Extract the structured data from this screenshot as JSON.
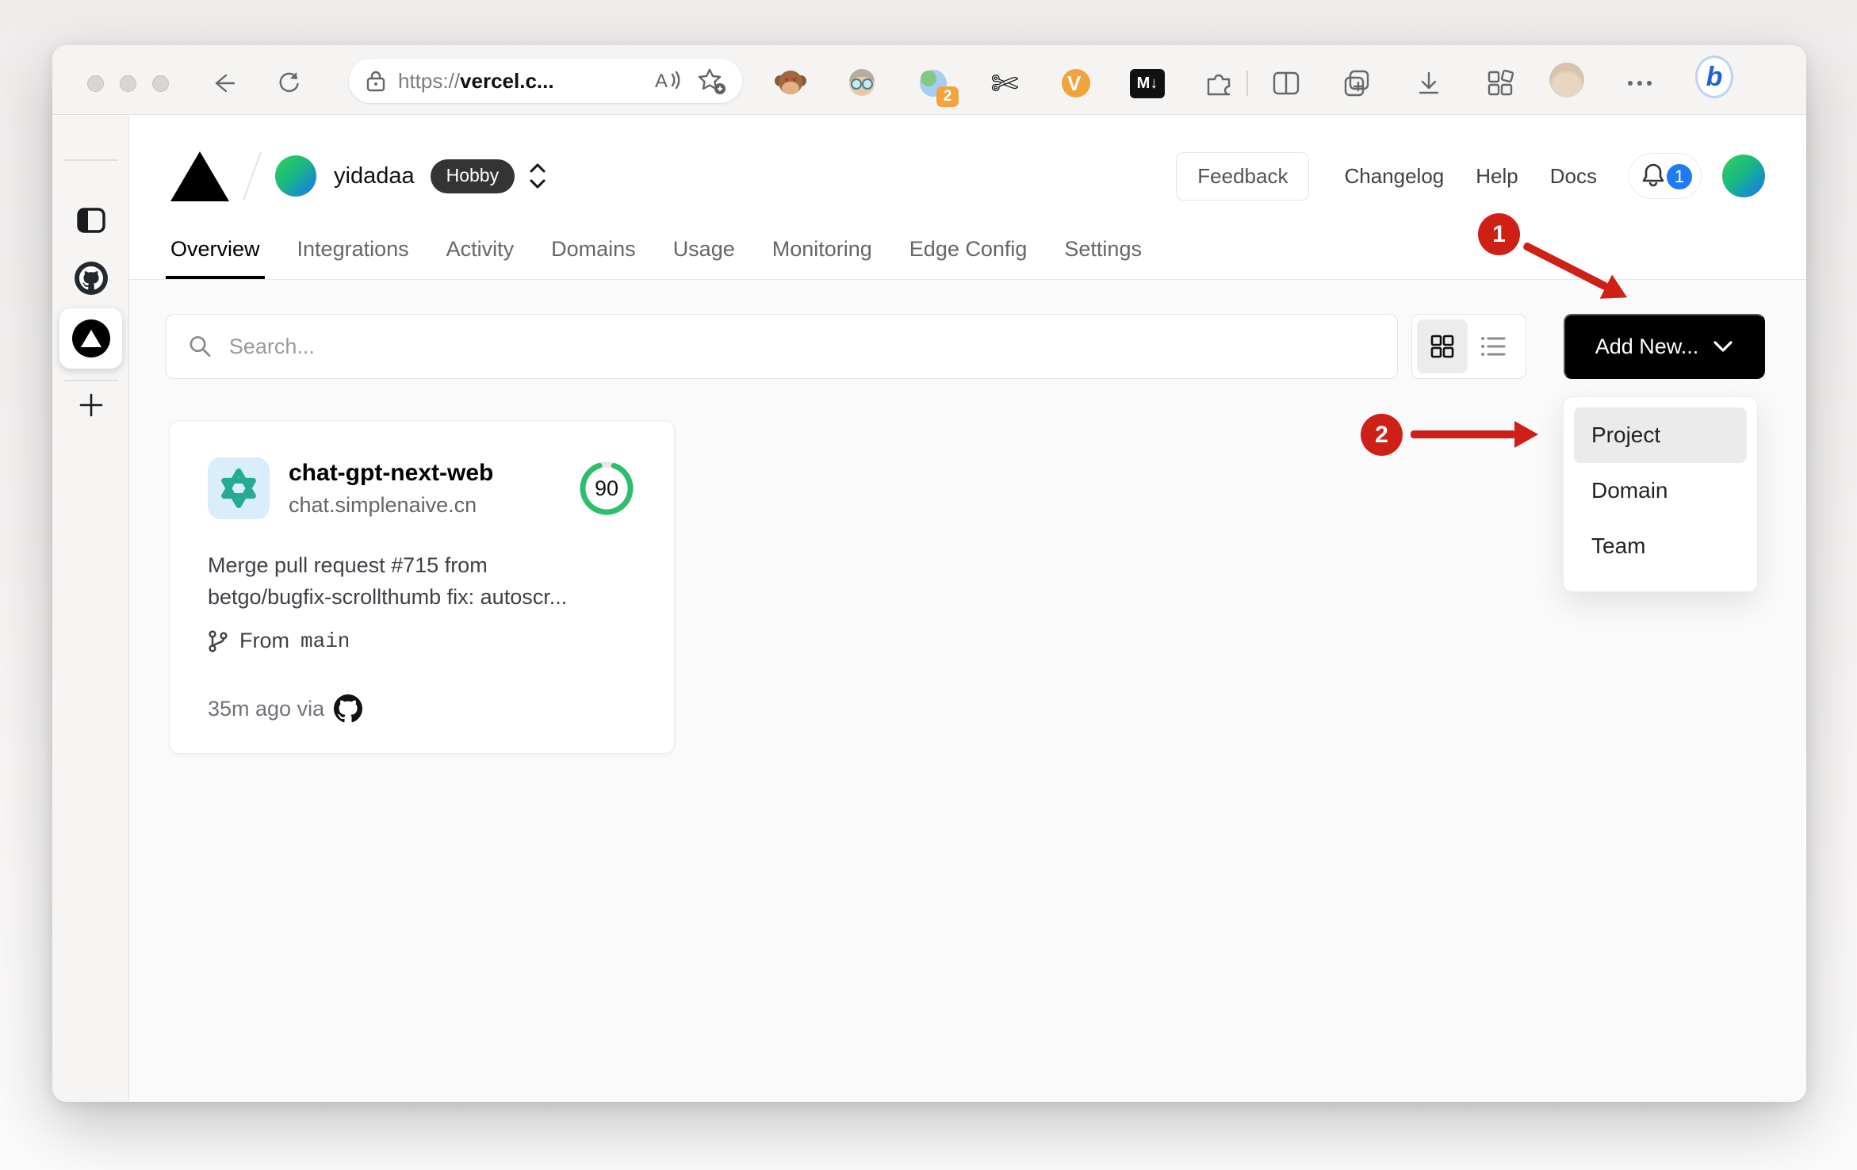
{
  "colors": {
    "annotation_red": "#cf2018",
    "notification_blue": "#1e7bf2",
    "score_green": "#2dbe6c",
    "button_black": "#000000"
  },
  "browser": {
    "url": {
      "scheme": "https://",
      "host": "vercel.c..."
    },
    "extensions": {
      "sync_badge": "2",
      "v_label": "V",
      "markdown_label": "M↓",
      "bing_label": "b"
    }
  },
  "vercel": {
    "team": {
      "name": "yidadaa",
      "plan": "Hobby"
    },
    "header": {
      "feedback": "Feedback",
      "changelog": "Changelog",
      "help": "Help",
      "docs": "Docs",
      "notification_count": "1"
    },
    "tabs": [
      {
        "label": "Overview"
      },
      {
        "label": "Integrations"
      },
      {
        "label": "Activity"
      },
      {
        "label": "Domains"
      },
      {
        "label": "Usage"
      },
      {
        "label": "Monitoring"
      },
      {
        "label": "Edge Config"
      },
      {
        "label": "Settings"
      }
    ],
    "controls": {
      "search_placeholder": "Search...",
      "add_new": "Add New..."
    },
    "dropdown": {
      "items": [
        {
          "label": "Project"
        },
        {
          "label": "Domain"
        },
        {
          "label": "Team"
        }
      ]
    },
    "project_card": {
      "title": "chat-gpt-next-web",
      "domain": "chat.simplenaive.cn",
      "score": "90",
      "commit_line1": "Merge pull request #715 from",
      "commit_line2": "betgo/bugfix-scrollthumb fix: autoscr...",
      "branch_prefix": "From",
      "branch_name": "main",
      "deployed": "35m ago via"
    }
  },
  "annotations": {
    "step1": "1",
    "step2": "2"
  }
}
